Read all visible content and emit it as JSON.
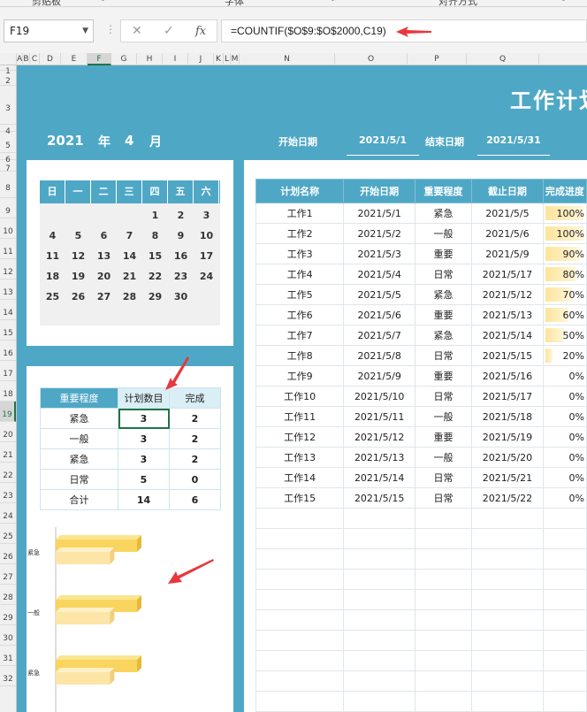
{
  "ribbon": {
    "groups": [
      "剪贴板",
      "字体",
      "对齐方式"
    ]
  },
  "formula_bar": {
    "cell_ref": "F19",
    "formula": "=COUNTIF($O$9:$O$2000,C19)",
    "cancel_icon": "cancel-icon",
    "confirm_icon": "check-icon",
    "fx_label": "fx"
  },
  "columns": [
    "A",
    "B",
    "C",
    "D",
    "E",
    "F",
    "G",
    "H",
    "I",
    "J",
    "K",
    "L",
    "M",
    "N",
    "O",
    "P",
    "Q"
  ],
  "rows": [
    "1",
    "2",
    "3",
    "4",
    "5",
    "6",
    "7",
    "8",
    "9",
    "10",
    "11",
    "12",
    "13",
    "14",
    "15",
    "16",
    "17",
    "18",
    "19",
    "20",
    "21",
    "22",
    "23",
    "24",
    "25",
    "26",
    "27",
    "28",
    "29",
    "30",
    "31",
    "32"
  ],
  "sheet": {
    "title": "工作计划",
    "year": "2021",
    "year_label": "年",
    "month": "4",
    "month_label": "月",
    "start_label": "开始日期",
    "start_date": "2021/5/1",
    "end_label": "结束日期",
    "end_date": "2021/5/31"
  },
  "calendar": {
    "weekdays": [
      "日",
      "一",
      "二",
      "三",
      "四",
      "五",
      "六"
    ],
    "weeks": [
      [
        "",
        "",
        "",
        "",
        "1",
        "2",
        "3"
      ],
      [
        "4",
        "5",
        "6",
        "7",
        "8",
        "9",
        "10"
      ],
      [
        "11",
        "12",
        "13",
        "14",
        "15",
        "16",
        "17"
      ],
      [
        "18",
        "19",
        "20",
        "21",
        "22",
        "23",
        "24"
      ],
      [
        "25",
        "26",
        "27",
        "28",
        "29",
        "30",
        ""
      ]
    ]
  },
  "summary": {
    "headers": [
      "重要程度",
      "计划数目",
      "完成"
    ],
    "rows": [
      [
        "紧急",
        "3",
        "2"
      ],
      [
        "一般",
        "3",
        "2"
      ],
      [
        "紧急",
        "3",
        "2"
      ],
      [
        "日常",
        "5",
        "0"
      ],
      [
        "合计",
        "14",
        "6"
      ]
    ]
  },
  "chart_data": {
    "type": "bar",
    "orientation": "horizontal",
    "categories": [
      "紧急",
      "一般",
      "紧急"
    ],
    "series": [
      {
        "values": [
          3,
          3,
          3
        ],
        "color": "#f9d55f"
      },
      {
        "values": [
          2,
          2,
          2
        ],
        "color": "#fde5a8"
      }
    ],
    "xlim": [
      0,
      3
    ]
  },
  "tasks": {
    "headers": [
      "计划名称",
      "开始日期",
      "重要程度",
      "截止日期",
      "完成进度"
    ],
    "rows": [
      {
        "name": "工作1",
        "start": "2021/5/1",
        "priority": "紧急",
        "due": "2021/5/5",
        "progress": "100%",
        "pct": 100
      },
      {
        "name": "工作2",
        "start": "2021/5/2",
        "priority": "一般",
        "due": "2021/5/6",
        "progress": "100%",
        "pct": 100
      },
      {
        "name": "工作3",
        "start": "2021/5/3",
        "priority": "重要",
        "due": "2021/5/9",
        "progress": "90%",
        "pct": 90
      },
      {
        "name": "工作4",
        "start": "2021/5/4",
        "priority": "日常",
        "due": "2021/5/17",
        "progress": "80%",
        "pct": 80
      },
      {
        "name": "工作5",
        "start": "2021/5/5",
        "priority": "紧急",
        "due": "2021/5/12",
        "progress": "70%",
        "pct": 70
      },
      {
        "name": "工作6",
        "start": "2021/5/6",
        "priority": "重要",
        "due": "2021/5/13",
        "progress": "60%",
        "pct": 60
      },
      {
        "name": "工作7",
        "start": "2021/5/7",
        "priority": "紧急",
        "due": "2021/5/14",
        "progress": "50%",
        "pct": 50
      },
      {
        "name": "工作8",
        "start": "2021/5/8",
        "priority": "日常",
        "due": "2021/5/15",
        "progress": "20%",
        "pct": 20
      },
      {
        "name": "工作9",
        "start": "2021/5/9",
        "priority": "重要",
        "due": "2021/5/16",
        "progress": "0%",
        "pct": 0
      },
      {
        "name": "工作10",
        "start": "2021/5/10",
        "priority": "日常",
        "due": "2021/5/17",
        "progress": "0%",
        "pct": 0
      },
      {
        "name": "工作11",
        "start": "2021/5/11",
        "priority": "一般",
        "due": "2021/5/18",
        "progress": "0%",
        "pct": 0
      },
      {
        "name": "工作12",
        "start": "2021/5/12",
        "priority": "重要",
        "due": "2021/5/19",
        "progress": "0%",
        "pct": 0
      },
      {
        "name": "工作13",
        "start": "2021/5/13",
        "priority": "一般",
        "due": "2021/5/20",
        "progress": "0%",
        "pct": 0
      },
      {
        "name": "工作14",
        "start": "2021/5/14",
        "priority": "日常",
        "due": "2021/5/21",
        "progress": "0%",
        "pct": 0
      },
      {
        "name": "工作15",
        "start": "2021/5/15",
        "priority": "日常",
        "due": "2021/5/22",
        "progress": "0%",
        "pct": 0
      }
    ],
    "empty_rows": 10
  },
  "colors": {
    "accent": "#4fa7c6",
    "selection": "#217346",
    "arrow": "#e8373d",
    "progress": "#fce49a"
  }
}
